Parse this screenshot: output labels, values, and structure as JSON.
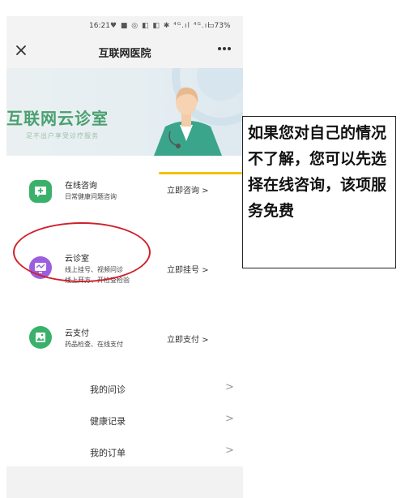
{
  "status_bar": {
    "time": "16:21",
    "indicators": "♥ ■  ◎ ◧ ◧ ✱ ⁴ᴳ.ıl ⁴ᴳ.ıl",
    "battery": "▭73%"
  },
  "header": {
    "close_icon": "close-icon",
    "title": "互联网医院",
    "more_icon": "more-icon"
  },
  "banner": {
    "title": "互联网云诊室",
    "subtitle": "足不出户享受诊疗服务"
  },
  "services": [
    {
      "name": "在线咨询",
      "desc1": "日常健康问题咨询",
      "desc2": "",
      "action": "立即咨询 >",
      "icon": "chat-plus-icon",
      "color": "#3ab16a"
    },
    {
      "name": "云诊室",
      "desc1": "线上挂号、视频问诊",
      "desc2": "线上开方、开检查检验",
      "action": "立即挂号 >",
      "icon": "monitor-icon",
      "color": "#9b5ee0"
    },
    {
      "name": "云支付",
      "desc1": "药品检查、在线支付",
      "desc2": "",
      "action": "立即支付 >",
      "icon": "image-icon",
      "color": "#3ab16a"
    }
  ],
  "menu": [
    {
      "label": "我的问诊",
      "chevron": ">"
    },
    {
      "label": "健康记录",
      "chevron": ">"
    },
    {
      "label": "我的订单",
      "chevron": ">"
    }
  ],
  "annotation": {
    "text": "如果您对自己的情况不了解，您可以先选择在线咨询，该项服务免费",
    "highlight_color": "#d0202a",
    "pointer_color": "#f2c200"
  }
}
